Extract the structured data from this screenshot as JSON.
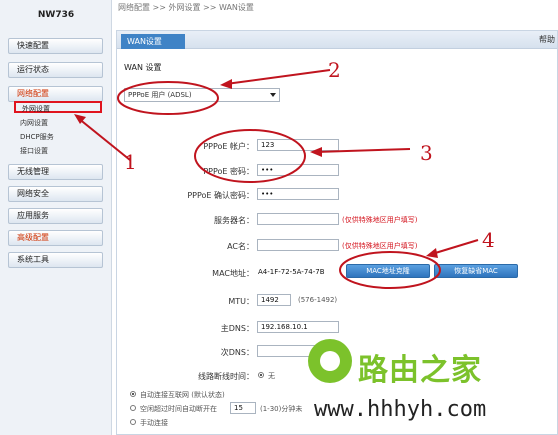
{
  "app": {
    "model": "NW736"
  },
  "breadcrumb": "网络配置 >> 外网设置 >> WAN设置",
  "sidebar": {
    "items": [
      {
        "label": "快速配置"
      },
      {
        "label": "运行状态"
      },
      {
        "label": "网络配置"
      },
      {
        "label": "无线管理"
      },
      {
        "label": "网络安全"
      },
      {
        "label": "应用服务"
      },
      {
        "label": "高级配置"
      },
      {
        "label": "系统工具"
      }
    ],
    "subitems": [
      {
        "label": "外网设置"
      },
      {
        "label": "内网设置"
      },
      {
        "label": "DHCP服务"
      },
      {
        "label": "接口设置"
      }
    ]
  },
  "panel": {
    "tab": "WAN设置",
    "help": "帮助",
    "section": "WAN 设置"
  },
  "form": {
    "wan_type": "PPPoE 用户 (ADSL)",
    "pppoe_user_label": "PPPoE 帐户：",
    "pppoe_user_value": "123",
    "pppoe_pass_label": "PPPoE 密码：",
    "pppoe_pass_value": "•••",
    "pppoe_confirm_label": "PPPoE 确认密码：",
    "pppoe_confirm_value": "•••",
    "server_label": "服务器名：",
    "server_hint": "(仅供特殊地区用户填写)",
    "ac_label": "AC名：",
    "ac_hint": "(仅供特殊地区用户填写)",
    "mac_label": "MAC地址：",
    "mac_value": "A4-1F-72-5A-74-7B",
    "mac_clone_button": "MAC地址克隆",
    "mac_default_button": "恢复缺省MAC",
    "mtu_label": "MTU：",
    "mtu_value": "1492",
    "mtu_range": "(576-1492)",
    "dns1_label": "主DNS：",
    "dns1_value": "192.168.10.1",
    "dns2_label": "次DNS：",
    "dns2_value": "",
    "timed_label": "线路断线时间：",
    "timed_option_a": "无",
    "conn_auto": "自动连接互联网 (默认状态)",
    "conn_idle": "空闲超过时间自动断开在",
    "conn_idle_value": "15",
    "conn_idle_unit": "(1-30)分钟未",
    "conn_manual": "手动连接"
  },
  "annotations": [
    "1",
    "2",
    "3",
    "4"
  ],
  "watermark": {
    "title": "路由之家",
    "url": "www.hhhyh.com"
  },
  "colors": {
    "accent": "#3f83c6",
    "annotation": "#c0141e",
    "watermark": "#7cc22b"
  }
}
